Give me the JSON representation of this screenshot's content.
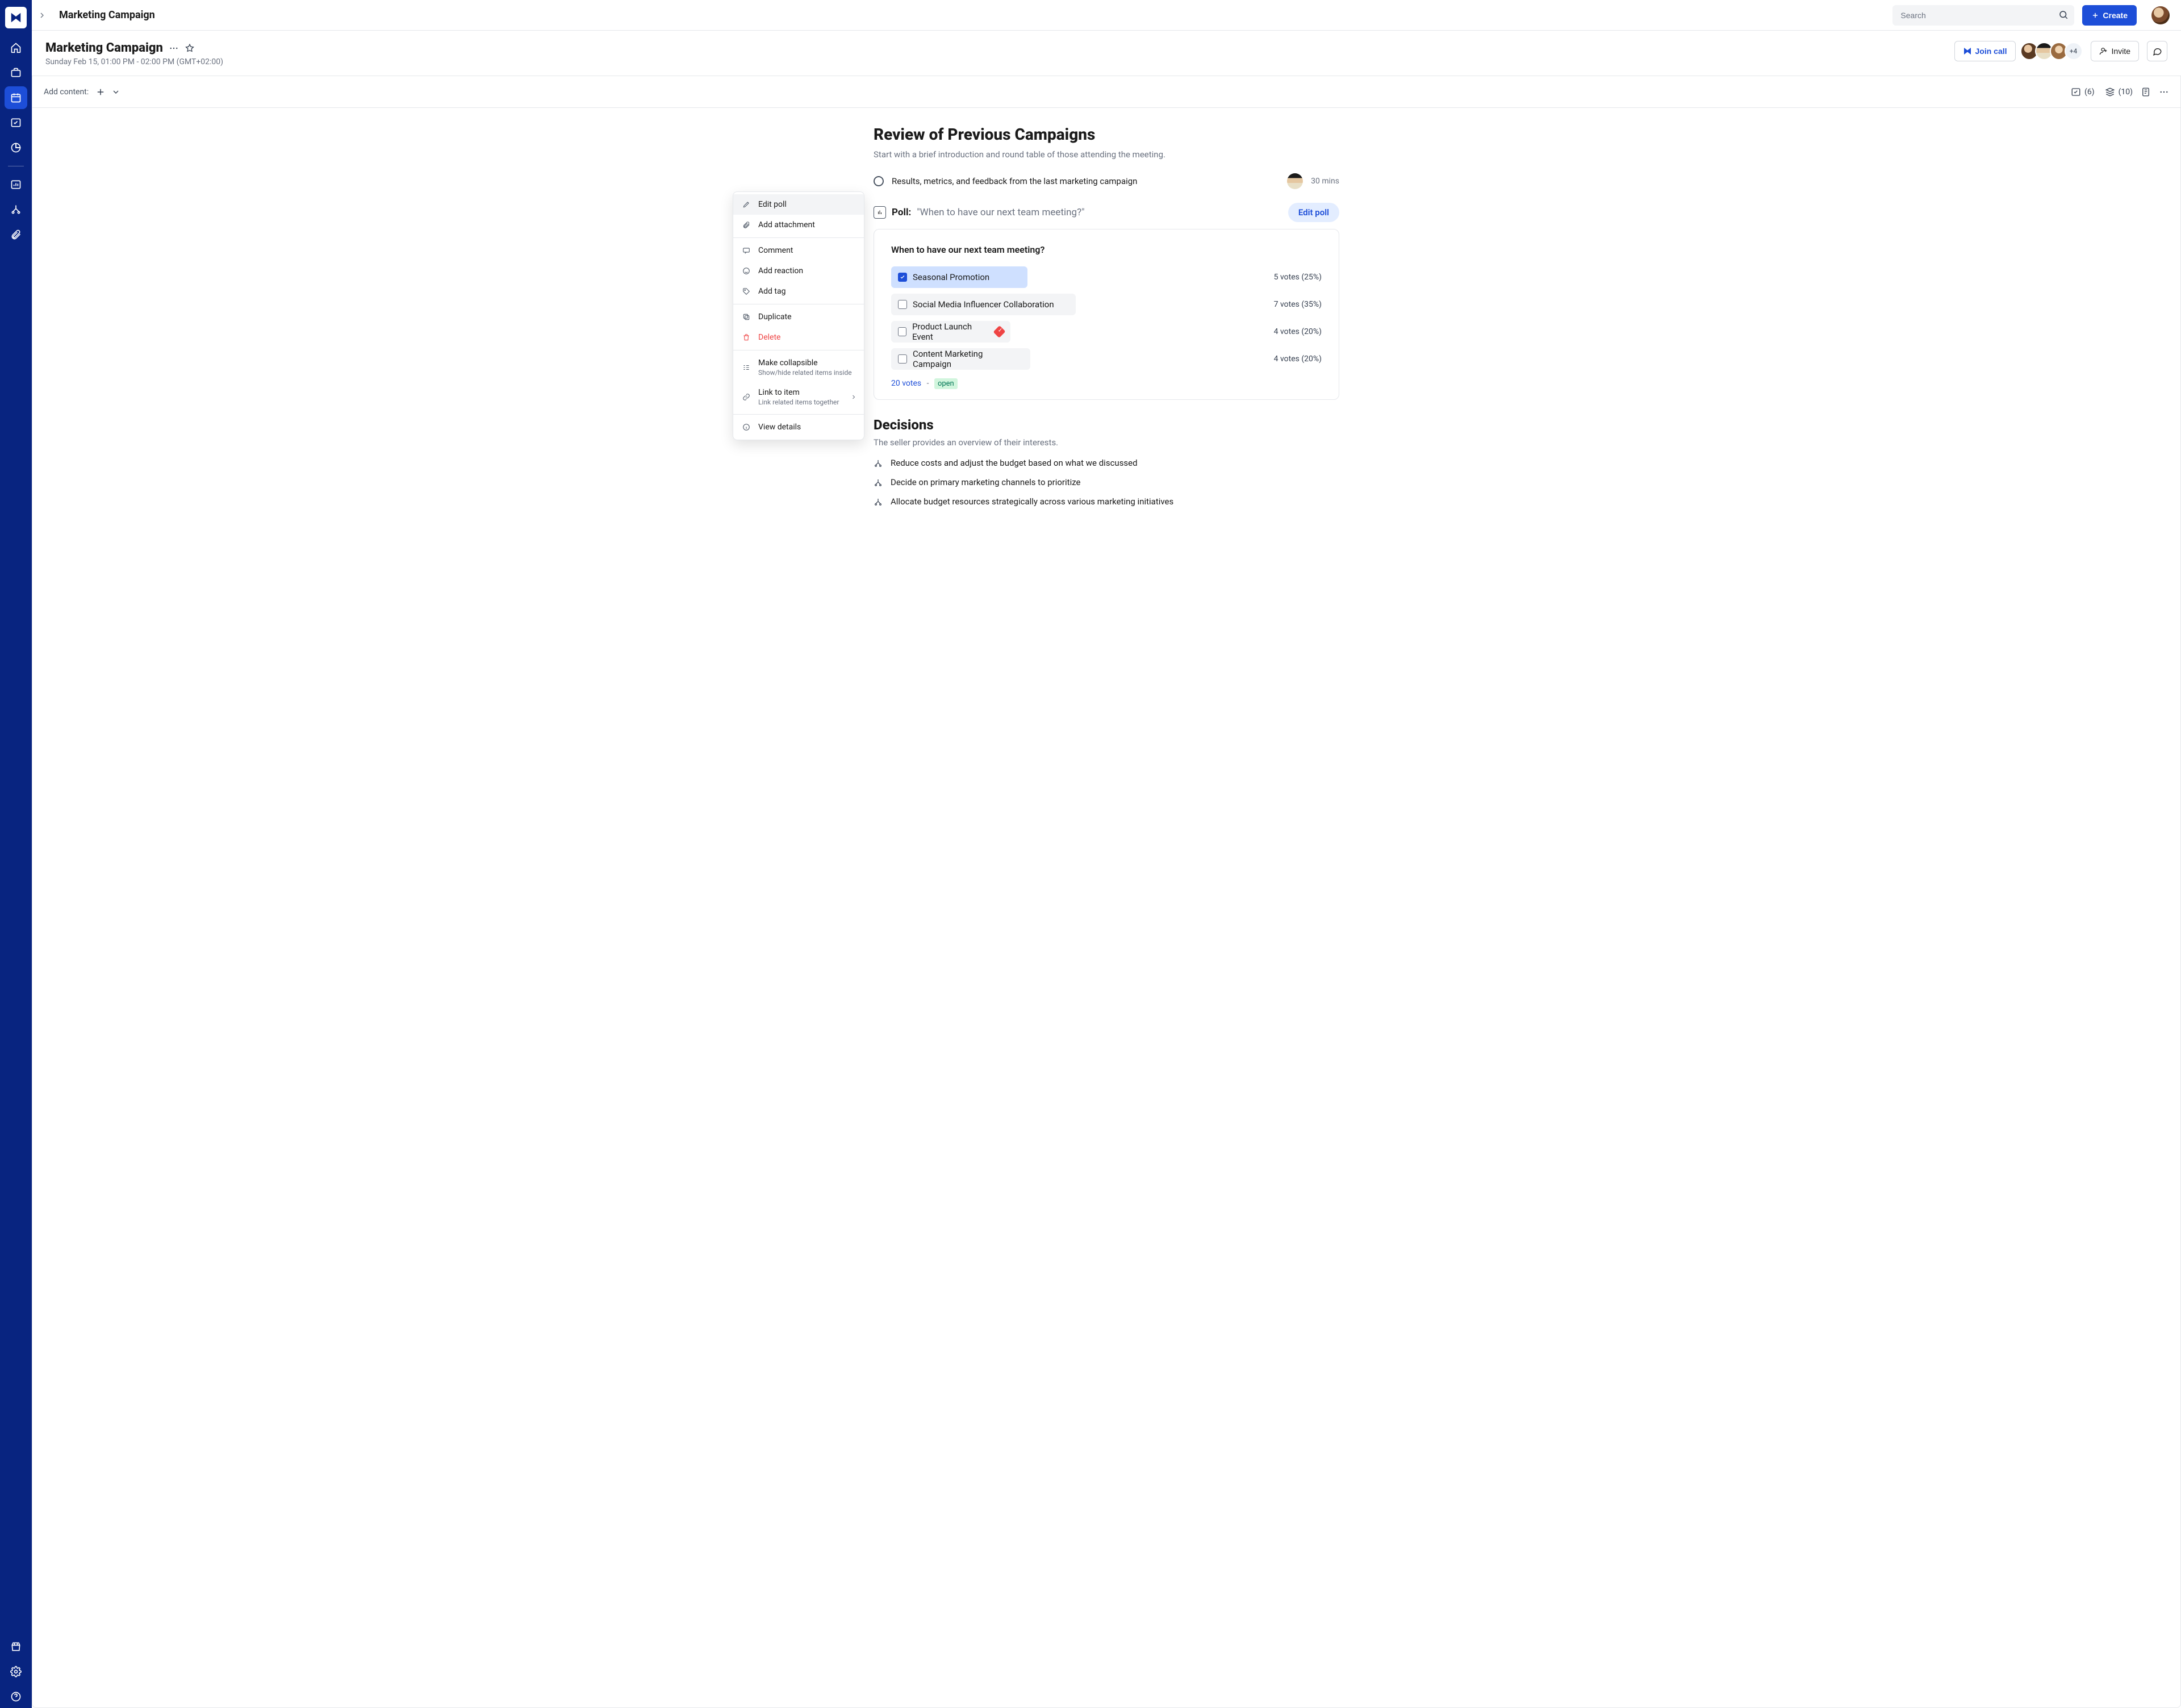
{
  "topbar": {
    "breadcrumb": "Marketing Campaign",
    "search_placeholder": "Search",
    "create_label": "Create"
  },
  "header": {
    "title": "Marketing Campaign",
    "datetime": "Sunday Feb 15, 01:00 PM - 02:00 PM (GMT+02:00)",
    "join_call_label": "Join call",
    "more_avatars": "+4",
    "invite_label": "Invite"
  },
  "content_toolbar": {
    "add_content_label": "Add content:",
    "count1": "(6)",
    "count2": "(10)"
  },
  "section1": {
    "title": "Review of Previous Campaigns",
    "subtitle": "Start with a brief introduction and round table of those attending the meeting.",
    "agenda_item": "Results, metrics, and feedback from the last marketing campaign",
    "duration": "30 mins"
  },
  "poll": {
    "prefix": "Poll:",
    "quoted": "\"When to have our next team meeting?\"",
    "edit_label": "Edit poll",
    "question": "When to have our next team meeting?",
    "options": [
      {
        "label": "Seasonal Promotion",
        "votes": "5 votes (25%)",
        "selected": true,
        "badge": false
      },
      {
        "label": "Social Media Influencer Collaboration",
        "votes": "7 votes (35%)",
        "selected": false,
        "badge": false
      },
      {
        "label": "Product Launch Event",
        "votes": "4 votes (20%)",
        "selected": false,
        "badge": true
      },
      {
        "label": "Content Marketing Campaign",
        "votes": "4 votes (20%)",
        "selected": false,
        "badge": false
      }
    ],
    "total": "20 votes",
    "state": "open"
  },
  "decisions": {
    "title": "Decisions",
    "subtitle": "The seller provides an overview of their interests.",
    "items": [
      "Reduce costs and adjust the budget based on what we discussed",
      "Decide on primary marketing channels to prioritize",
      "Allocate budget resources strategically across various marketing initiatives"
    ]
  },
  "context_menu": {
    "edit_poll": "Edit poll",
    "add_attachment": "Add attachment",
    "comment": "Comment",
    "add_reaction": "Add reaction",
    "add_tag": "Add tag",
    "duplicate": "Duplicate",
    "delete": "Delete",
    "make_collapsible": "Make collapsible",
    "make_collapsible_desc": "Show/hide related items inside",
    "link_to_item": "Link to item",
    "link_to_item_desc": "Link related items together",
    "view_details": "View details"
  }
}
